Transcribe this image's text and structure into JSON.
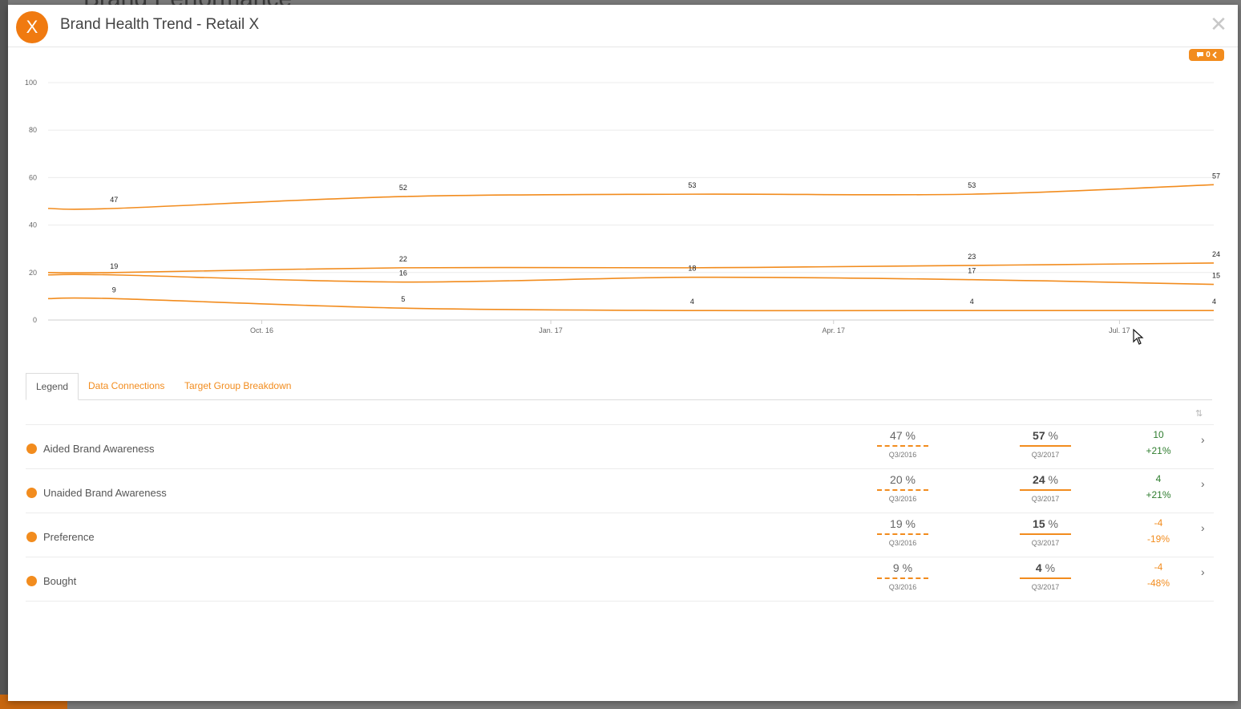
{
  "backdrop": {
    "title": "Brand Performance"
  },
  "modal": {
    "avatar_letter": "X",
    "title": "Brand Health Trend - Retail X",
    "comment_count": "0"
  },
  "tabs": [
    {
      "label": "Legend",
      "active": true
    },
    {
      "label": "Data Connections",
      "active": false
    },
    {
      "label": "Target Group Breakdown",
      "active": false
    }
  ],
  "legend": {
    "rows": [
      {
        "label": "Aided Brand Awareness",
        "prev_value": "47",
        "prev_period": "Q3/2016",
        "curr_value": "57",
        "curr_period": "Q3/2017",
        "delta_abs": "10",
        "delta_pct": "+21%",
        "trend": "pos"
      },
      {
        "label": "Unaided Brand Awareness",
        "prev_value": "20",
        "prev_period": "Q3/2016",
        "curr_value": "24",
        "curr_period": "Q3/2017",
        "delta_abs": "4",
        "delta_pct": "+21%",
        "trend": "pos"
      },
      {
        "label": "Preference",
        "prev_value": "19",
        "prev_period": "Q3/2016",
        "curr_value": "15",
        "curr_period": "Q3/2017",
        "delta_abs": "-4",
        "delta_pct": "-19%",
        "trend": "neg"
      },
      {
        "label": "Bought",
        "prev_value": "9",
        "prev_period": "Q3/2016",
        "curr_value": "4",
        "curr_period": "Q3/2017",
        "delta_abs": "-4",
        "delta_pct": "-48%",
        "trend": "neg"
      }
    ],
    "percent_suffix": " %"
  },
  "chart_data": {
    "type": "line",
    "title": "",
    "xlabel": "",
    "ylabel": "",
    "ylim": [
      0,
      100
    ],
    "yticks": [
      0,
      20,
      40,
      60,
      80,
      100
    ],
    "grid": true,
    "x_ticks": [
      {
        "label": "Oct. 16",
        "x": "2016-10-01"
      },
      {
        "label": "Jan. 17",
        "x": "2017-01-01"
      },
      {
        "label": "Apr. 17",
        "x": "2017-04-01"
      },
      {
        "label": "Jul. 17",
        "x": "2017-07-01"
      }
    ],
    "x_range": [
      "2016-07-25",
      "2017-07-31"
    ],
    "x": [
      "2016-08-15",
      "2016-11-15",
      "2017-02-15",
      "2017-05-15",
      "2017-07-31"
    ],
    "color": "#f28c1e",
    "series": [
      {
        "name": "Aided Brand Awareness",
        "values": [
          47,
          52,
          53,
          53,
          57
        ]
      },
      {
        "name": "Unaided Brand Awareness",
        "values": [
          20,
          22,
          22,
          23,
          24
        ]
      },
      {
        "name": "Preference",
        "values": [
          19,
          16,
          18,
          17,
          15
        ]
      },
      {
        "name": "Bought",
        "values": [
          9,
          5,
          4,
          4,
          4
        ]
      }
    ],
    "point_labels": [
      {
        "series": 0,
        "labels": [
          "47",
          "52",
          "53",
          "53",
          "57"
        ]
      },
      {
        "series": 1,
        "labels": [
          "",
          "22",
          "",
          "23",
          "24"
        ]
      },
      {
        "series": 2,
        "labels": [
          "19",
          "16",
          "18",
          "17",
          "15"
        ]
      },
      {
        "series": 3,
        "labels": [
          "9",
          "5",
          "4",
          "4",
          "4"
        ]
      }
    ]
  }
}
